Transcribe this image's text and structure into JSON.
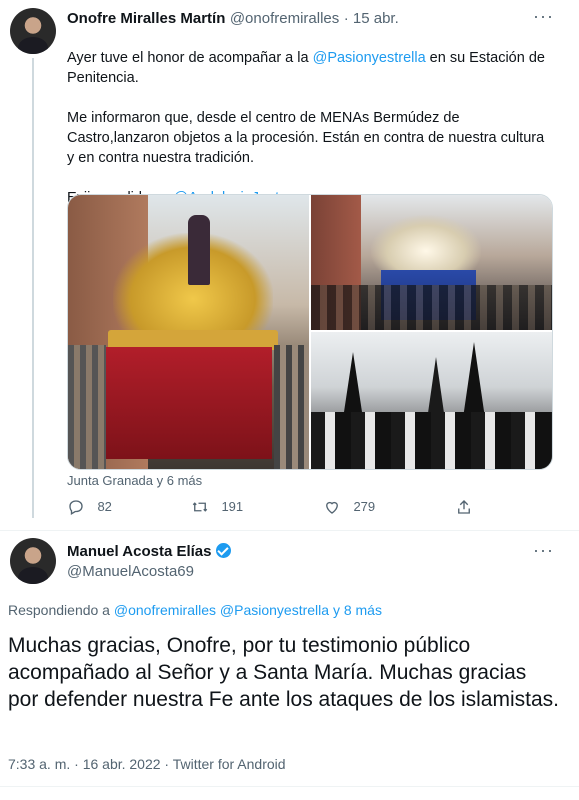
{
  "tweet1": {
    "name": "Onofre Miralles Martín",
    "handle": "@onofremiralles",
    "time": "· 15 abr.",
    "text_a": "Ayer tuve el honor de acompañar a la ",
    "mention_a": "@Pasionyestrella",
    "text_b": " en su Estación de\nPenitencia.\n\nMe informaron que, desde el centro de MENAs Bermúdez de\nCastro,lanzaron objetos a la procesión. Están en contra de nuestra cultura\ny en contra nuestra tradición.\n\nExijo medidas a ",
    "mention_b": "@AndaluciaJunta",
    "caption": "Junta Granada y 6 más",
    "replies": "82",
    "retweets": "191",
    "likes": "279"
  },
  "tweet2": {
    "name": "Manuel Acosta Elías",
    "handle": "@ManuelAcosta69",
    "replying_prefix": "Respondiendo a ",
    "replying_handles": "@onofremiralles @Pasionyestrella y 8 más",
    "text": "Muchas gracias, Onofre, por tu testimonio público acompañado al Señor y a Santa María. Muchas gracias por defender nuestra Fe ante los ataques de los islamistas.",
    "meta": "7:33 a. m. · 16 abr. 2022 · Twitter for Android"
  },
  "icons": {
    "more": "more-icon",
    "reply": "reply-icon",
    "retweet": "retweet-icon",
    "like": "like-icon",
    "share": "share-icon",
    "verified": "verified-badge-icon"
  },
  "colors": {
    "link": "#1d9bf0",
    "muted": "#536471"
  }
}
